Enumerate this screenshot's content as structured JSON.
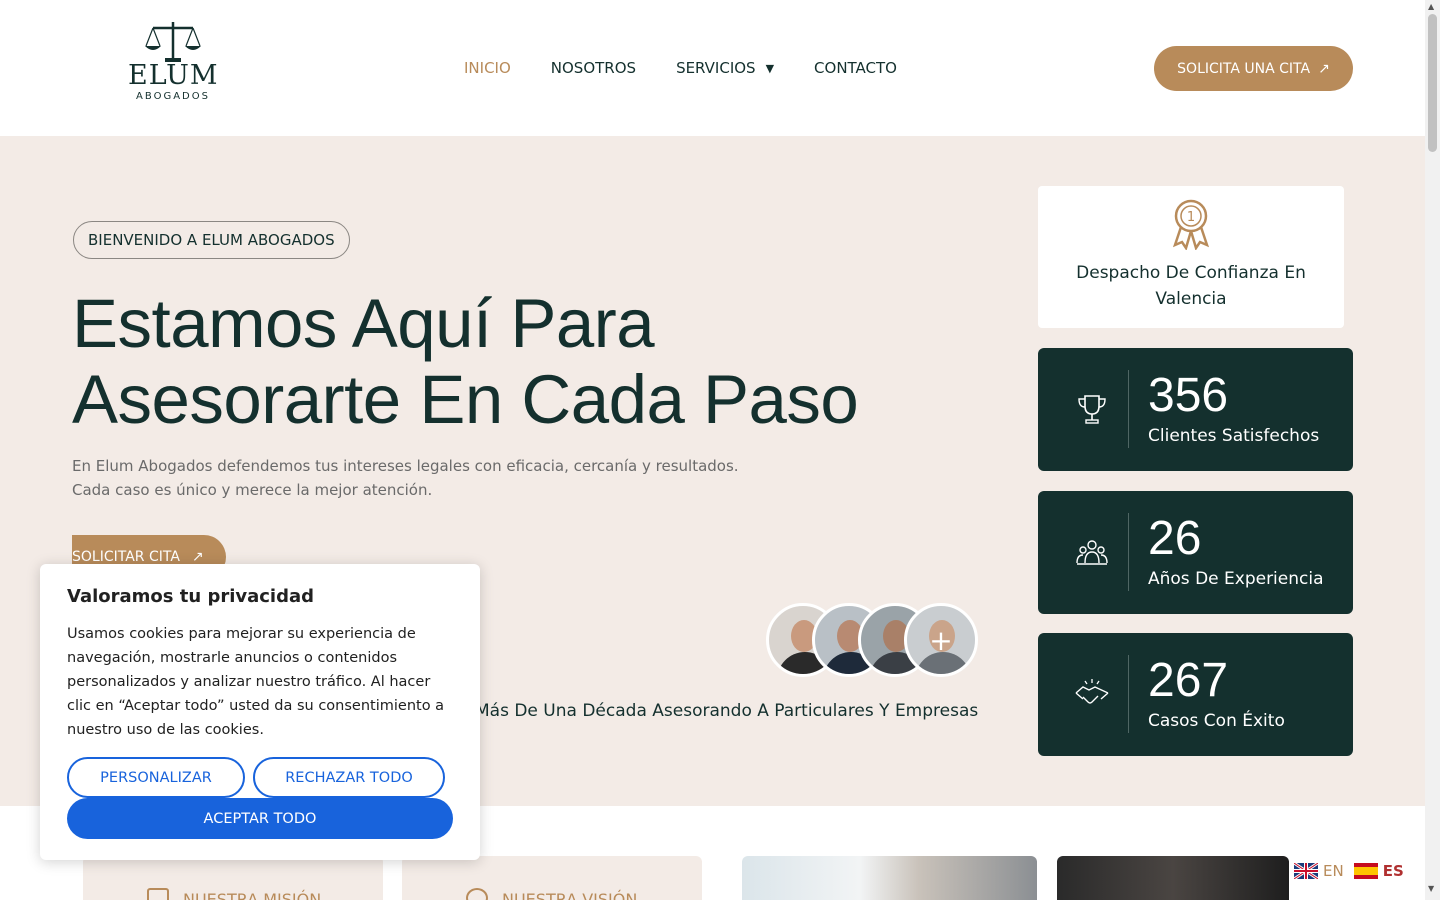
{
  "brand": {
    "name": "ELUM",
    "subtitle": "ABOGADOS",
    "accent_color": "#b88b5a",
    "dark_color": "#14302e"
  },
  "nav": {
    "items": [
      {
        "label": "INICIO",
        "active": true
      },
      {
        "label": "NOSOTROS",
        "active": false
      },
      {
        "label": "SERVICIOS",
        "active": false,
        "dropdown": true
      },
      {
        "label": "CONTACTO",
        "active": false
      }
    ],
    "cta_label": "SOLICITA UNA CITA"
  },
  "hero": {
    "badge": "BIENVENIDO A ELUM ABOGADOS",
    "title_line1": "Estamos Aquí Para",
    "title_line2": "Asesorarte En Cada Paso",
    "desc_line1": "En Elum Abogados defendemos tus intereses legales con eficacia, cercanía y resultados.",
    "desc_line2": "Cada caso es único y merece la mejor atención.",
    "cta_label": "SOLICITAR CITA",
    "decade_text": "Más De Una Década Asesorando A Particulares Y Empresas"
  },
  "trust": {
    "icon": "award-ribbon-icon",
    "badge_number": "1",
    "text": "Despacho De Confianza En Valencia"
  },
  "stats": [
    {
      "icon": "trophy-icon",
      "value": "356",
      "label": "Clientes Satisfechos"
    },
    {
      "icon": "team-icon",
      "value": "26",
      "label": "Años De Experiencia"
    },
    {
      "icon": "handshake-icon",
      "value": "267",
      "label": "Casos Con Éxito"
    }
  ],
  "lower": {
    "card1_title": "NUESTRA MISIÓN",
    "card2_title": "NUESTRA VISIÓN"
  },
  "cookie": {
    "title": "Valoramos tu privacidad",
    "text": "Usamos cookies para mejorar su experiencia de navegación, mostrarle anuncios o contenidos personalizados y analizar nuestro tráfico. Al hacer clic en “Aceptar todo” usted da su consentimiento a nuestro uso de las cookies.",
    "customize_label": "PERSONALIZAR",
    "reject_label": "RECHAZAR TODO",
    "accept_label": "ACEPTAR TODO",
    "button_color": "#1863dc"
  },
  "language": {
    "en_label": "EN",
    "es_label": "ES"
  }
}
